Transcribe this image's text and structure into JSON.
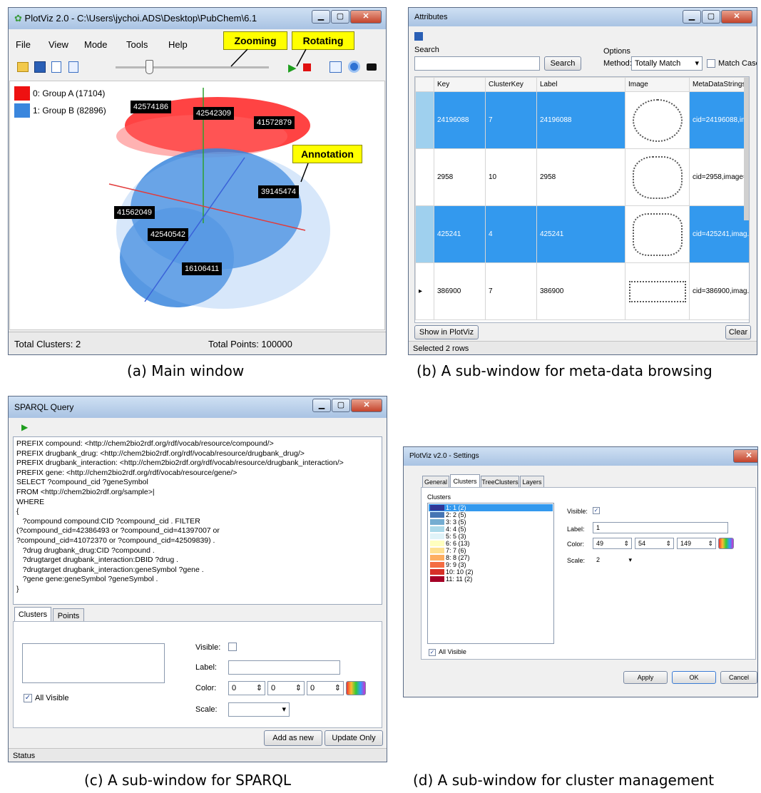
{
  "panel_a": {
    "title": "PlotViz 2.0 - C:\\Users\\jychoi.ADS\\Desktop\\PubChem\\6.1",
    "menu": [
      "File",
      "View",
      "Mode",
      "Tools",
      "Help"
    ],
    "legend": [
      {
        "label": "0: Group A (17104)",
        "color": "#ee1111"
      },
      {
        "label": "1: Group B (82896)",
        "color": "#3a86dd"
      }
    ],
    "annotations": [
      "42574186",
      "42542309",
      "41572879",
      "39145474",
      "41562049",
      "42540542",
      "16106411"
    ],
    "callouts": {
      "zooming": "Zooming",
      "rotating": "Rotating",
      "annotation": "Annotation"
    },
    "status_left": "Total Clusters: 2",
    "status_right": "Total Points: 100000",
    "caption": "(a) Main window"
  },
  "panel_b": {
    "title": "Attributes",
    "search_label": "Search",
    "search_button": "Search",
    "options_label": "Options",
    "method_label": "Method:",
    "method_value": "Totally Match",
    "match_case": "Match Case",
    "columns": [
      "Key",
      "ClusterKey",
      "Label",
      "Image",
      "MetaDataStrings"
    ],
    "rows": [
      {
        "key": "24196088",
        "cluster": "7",
        "label": "24196088",
        "meta": "cid=24196088,im...",
        "selected": true
      },
      {
        "key": "2958",
        "cluster": "10",
        "label": "2958",
        "meta": "cid=2958,image=...",
        "selected": false
      },
      {
        "key": "425241",
        "cluster": "4",
        "label": "425241",
        "meta": "cid=425241,imag...",
        "selected": true
      },
      {
        "key": "386900",
        "cluster": "7",
        "label": "386900",
        "meta": "cid=386900,imag...",
        "selected": false
      }
    ],
    "show_button": "Show in PlotViz",
    "clear_button": "Clear",
    "status": "Selected 2 rows",
    "caption": "(b) A sub-window for meta-data browsing"
  },
  "panel_c": {
    "title": "SPARQL Query",
    "query": "PREFIX compound: <http://chem2bio2rdf.org/rdf/vocab/resource/compound/>\nPREFIX drugbank_drug: <http://chem2bio2rdf.org/rdf/vocab/resource/drugbank_drug/>\nPREFIX drugbank_interaction: <http://chem2bio2rdf.org/rdf/vocab/resource/drugbank_interaction/>\nPREFIX gene: <http://chem2bio2rdf.org/rdf/vocab/resource/gene/>\nSELECT ?compound_cid ?geneSymbol\nFROM <http://chem2bio2rdf.org/sample>|\nWHERE\n{\n   ?compound compound:CID ?compound_cid . FILTER\n(?compound_cid=42386493 or ?compound_cid=41397007 or\n?compound_cid=41072370 or ?compound_cid=42509839) .\n   ?drug drugbank_drug:CID ?compound .\n   ?drugtarget drugbank_interaction:DBID ?drug .\n   ?drugtarget drugbank_interaction:geneSymbol ?gene .\n   ?gene gene:geneSymbol ?geneSymbol .\n}",
    "tabs": [
      "Clusters",
      "Points"
    ],
    "visible_label": "Visible:",
    "label_label": "Label:",
    "color_label": "Color:",
    "scale_label": "Scale:",
    "color_values": [
      "0",
      "0",
      "0"
    ],
    "all_visible": "All Visible",
    "add_button": "Add as new",
    "update_button": "Update Only",
    "status": "Status",
    "caption": "(c) A sub-window for SPARQL"
  },
  "panel_d": {
    "title": "PlotViz v2.0 - Settings",
    "tabs": [
      "General",
      "Clusters",
      "TreeClusters",
      "Layers"
    ],
    "clusters_label": "Clusters",
    "clusters": [
      {
        "label": "1: 1 (2)",
        "color": "#313695"
      },
      {
        "label": "2: 2 (5)",
        "color": "#4575b4"
      },
      {
        "label": "3: 3 (5)",
        "color": "#74add1"
      },
      {
        "label": "4: 4 (5)",
        "color": "#abd9e9"
      },
      {
        "label": "5: 5 (3)",
        "color": "#e0f3f8"
      },
      {
        "label": "6: 6 (13)",
        "color": "#ffffbf"
      },
      {
        "label": "7: 7 (6)",
        "color": "#fee090"
      },
      {
        "label": "8: 8 (27)",
        "color": "#fdae61"
      },
      {
        "label": "9: 9 (3)",
        "color": "#f46d43"
      },
      {
        "label": "10: 10 (2)",
        "color": "#d73027"
      },
      {
        "label": "11: 11 (2)",
        "color": "#a50026"
      }
    ],
    "visible_label": "Visible:",
    "label_label": "Label:",
    "label_value": "1",
    "color_label": "Color:",
    "color_values": [
      "49",
      "54",
      "149"
    ],
    "scale_label": "Scale:",
    "scale_value": "2",
    "all_visible": "All Visible",
    "apply_button": "Apply",
    "ok_button": "OK",
    "cancel_button": "Cancel",
    "caption": "(d) A sub-window for cluster management"
  }
}
